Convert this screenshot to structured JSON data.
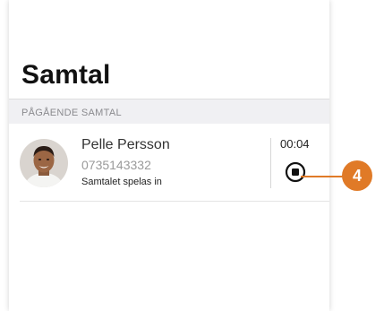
{
  "header": {
    "title": "Samtal"
  },
  "section": {
    "label": "PÅGÅENDE SAMTAL"
  },
  "call": {
    "name": "Pelle Persson",
    "number": "0735143332",
    "status": "Samtalet spelas in",
    "duration": "00:04",
    "action_icon": "stop-record-icon"
  },
  "annotation": {
    "badge": "4",
    "color": "#e07a27"
  }
}
